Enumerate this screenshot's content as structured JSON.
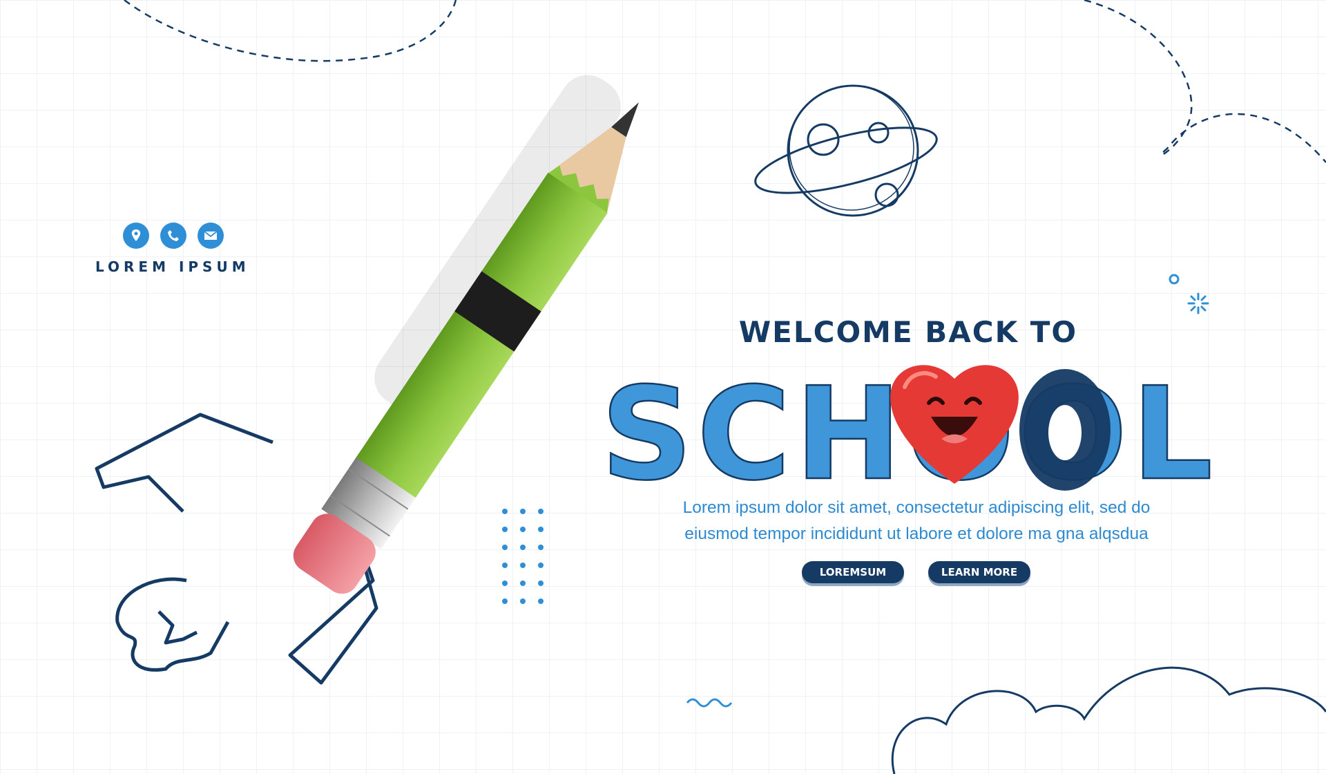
{
  "contact": {
    "icons": [
      "location-pin-icon",
      "phone-icon",
      "mail-icon"
    ],
    "label": "LOREM IPSUM"
  },
  "hero": {
    "headline": "WELCOME BACK TO",
    "school_word": "SCHOOL",
    "body_line1": "Lorem ipsum dolor sit amet, consectetur adipiscing elit, sed do",
    "body_line2": "eiusmod tempor incididunt ut labore et dolore ma gna alqsdua"
  },
  "buttons": {
    "primary_label": "LOREMSUM",
    "secondary_label": "LEARN MORE"
  },
  "colors": {
    "navy": "#153a64",
    "blue": "#2f8fd6",
    "pencil_green": "#8cc63f",
    "eraser_pink": "#e8747c",
    "heart_red": "#e53935"
  }
}
